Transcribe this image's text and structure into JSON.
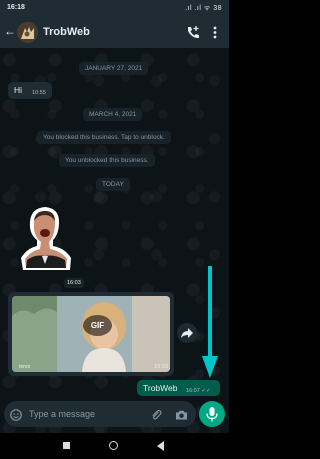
{
  "status_bar": {
    "time": "16:18",
    "icons": ".ıl .ıl ᯤ 38"
  },
  "header": {
    "name": "TrobWeb",
    "back": "←"
  },
  "messages": {
    "date1": "JANUARY 27, 2021",
    "hi_text": "Hi",
    "hi_time": "10:55",
    "date2": "MARCH 4, 2021",
    "sys1": "You blocked this business. Tap to unblock.",
    "sys2": "You unblocked this business.",
    "date3": "TODAY",
    "sticker_time": "16:03",
    "gif_label": "GIF",
    "gif_source": "tenor",
    "gif_time": "16:03",
    "out_text": "TrobWeb",
    "out_time": "16:07 ✓✓"
  },
  "input": {
    "placeholder": "Type a message"
  },
  "colors": {
    "accent": "#00a884",
    "annotation_arrow": "#00c6c9",
    "header": "#1f2c34",
    "outgoing": "#005c4b"
  }
}
